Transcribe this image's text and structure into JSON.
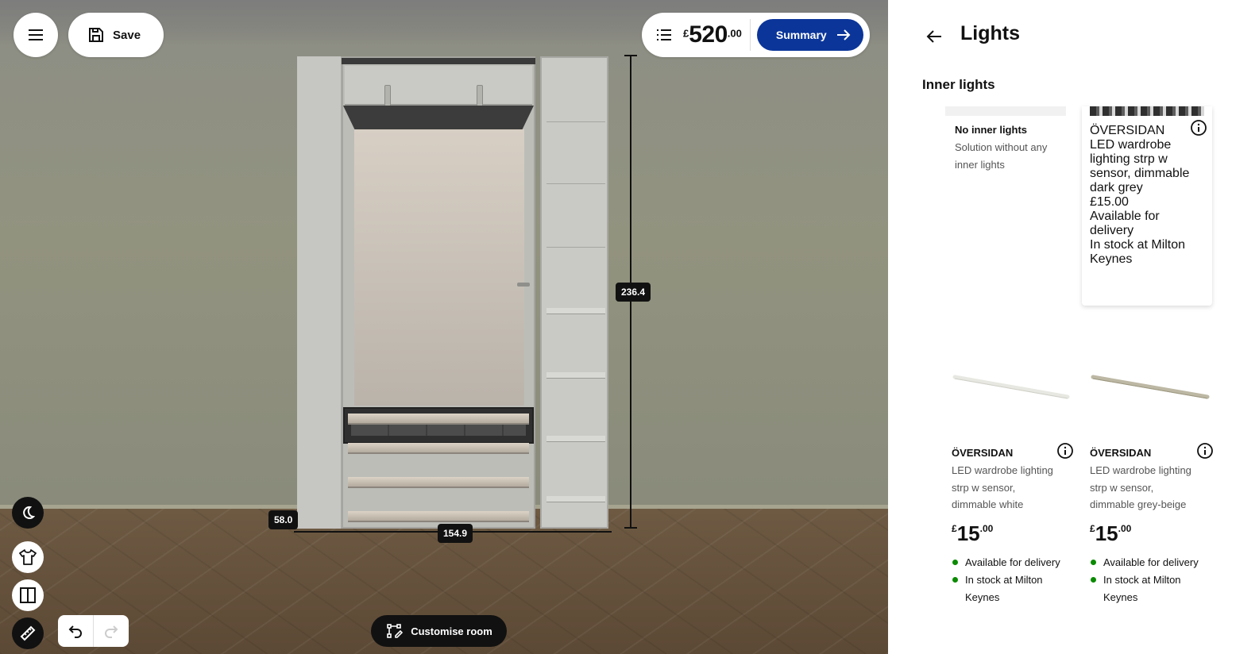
{
  "toolbar": {
    "save_label": "Save",
    "total_currency": "£",
    "total_main": "520",
    "total_decimals": ".00",
    "summary_label": "Summary"
  },
  "dimensions": {
    "height": "236.4",
    "width": "154.9",
    "depth": "58.0"
  },
  "bottom": {
    "customise_label": "Customise room"
  },
  "panel": {
    "title": "Lights",
    "section_title": "Inner lights",
    "options": [
      {
        "name": "No inner lights",
        "description": "Solution without any inner lights",
        "selected": false
      },
      {
        "name": "ÖVERSIDAN",
        "description": "LED wardrobe lighting strp w sensor, dimmable dark grey",
        "currency": "£",
        "price_main": "15",
        "price_decimals": ".00",
        "availability": [
          "Available for delivery",
          "In stock at Milton Keynes"
        ],
        "selected": true
      },
      {
        "name": "ÖVERSIDAN",
        "description": "LED wardrobe lighting strp w sensor, dimmable white",
        "currency": "£",
        "price_main": "15",
        "price_decimals": ".00",
        "availability": [
          "Available for delivery",
          "In stock at Milton Keynes"
        ],
        "selected": false
      },
      {
        "name": "ÖVERSIDAN",
        "description": "LED wardrobe lighting strp w sensor, dimmable grey-beige",
        "currency": "£",
        "price_main": "15",
        "price_decimals": ".00",
        "availability": [
          "Available for delivery",
          "In stock at Milton Keynes"
        ],
        "selected": false
      }
    ]
  },
  "colors": {
    "accent": "#0b3599",
    "in_stock": "#0a8a00"
  },
  "icons": {
    "menu": "menu-icon",
    "save": "floppy-disk-icon",
    "list": "list-icon",
    "summary_arrow": "arrow-right-icon",
    "theme": "moon-icon",
    "style": "shirt-icon",
    "doors": "wardrobe-doors-icon",
    "measure": "ruler-icon",
    "undo": "undo-icon",
    "redo": "redo-icon",
    "customise": "room-edit-icon",
    "back": "arrow-left-icon",
    "info": "info-icon"
  }
}
